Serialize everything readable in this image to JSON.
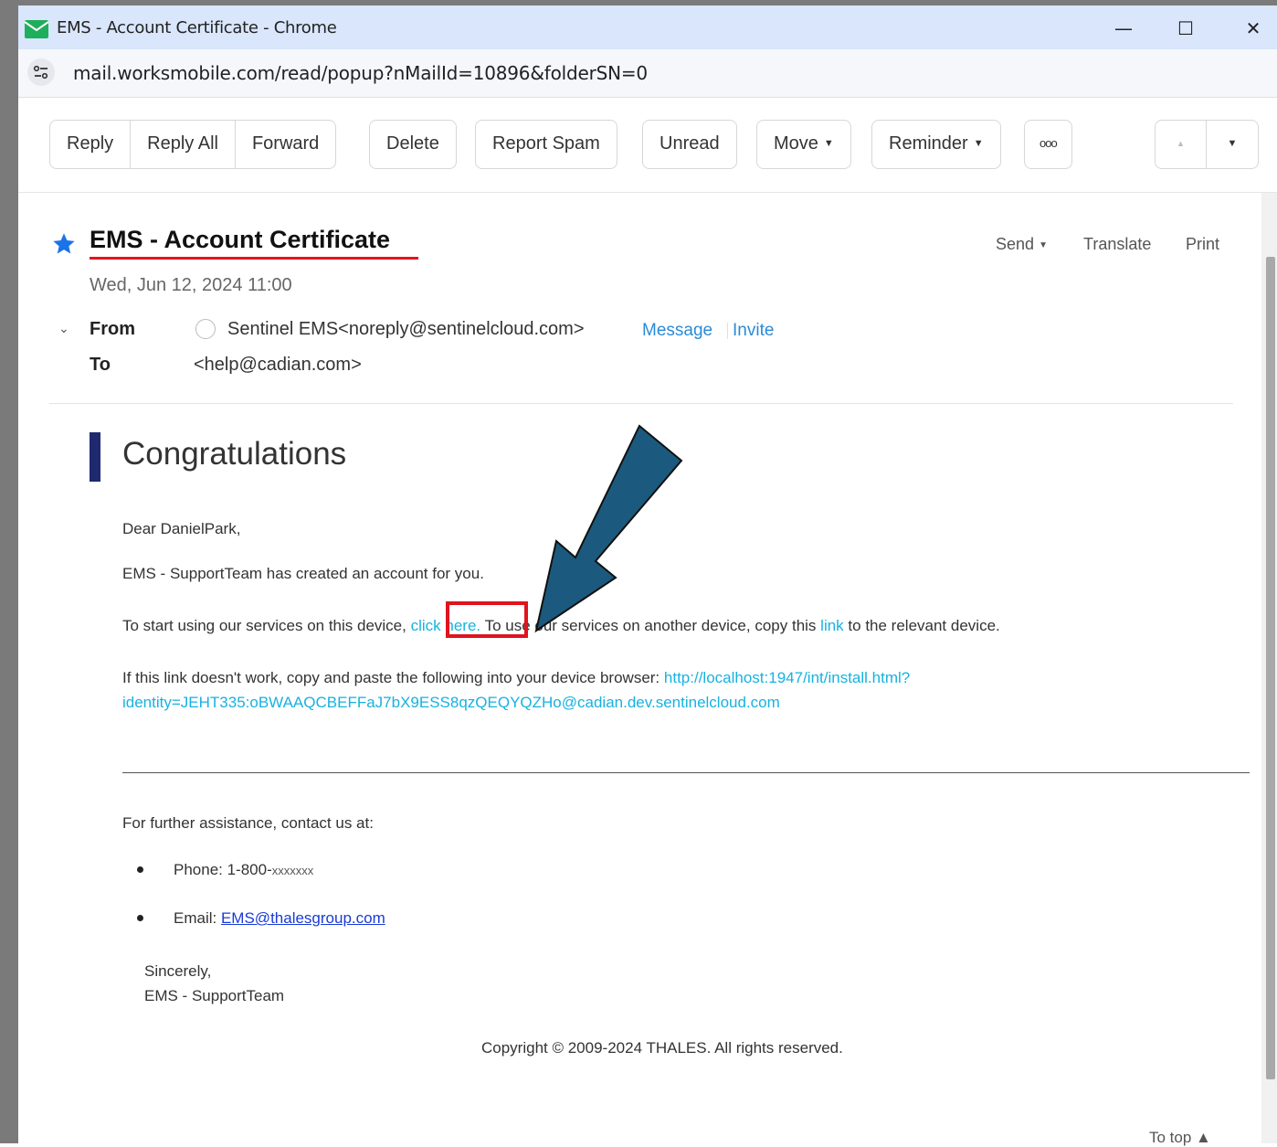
{
  "window": {
    "title": "EMS - Account Certificate - Chrome",
    "controls": {
      "minimize": "—",
      "maximize": "☐",
      "close": "✕"
    }
  },
  "address_bar": {
    "url": "mail.worksmobile.com/read/popup?nMailId=10896&folderSN=0"
  },
  "toolbar": {
    "reply": "Reply",
    "reply_all": "Reply All",
    "forward": "Forward",
    "delete": "Delete",
    "report_spam": "Report Spam",
    "unread": "Unread",
    "move": "Move",
    "reminder": "Reminder",
    "more": "ooo",
    "prev": "▲",
    "next": "▼"
  },
  "mail": {
    "subject": "EMS - Account Certificate",
    "actions": {
      "send": "Send",
      "translate": "Translate",
      "print": "Print"
    },
    "date": "Wed, Jun 12, 2024 11:00",
    "from_label": "From",
    "from_value": "Sentinel EMS<noreply@sentinelcloud.com>",
    "message_link": "Message",
    "invite_link": "Invite",
    "to_label": "To",
    "to_value": "<help@cadian.com>"
  },
  "body": {
    "heading": "Congratulations",
    "greeting": "Dear DanielPark,",
    "created": "EMS - SupportTeam has created an account for you.",
    "start_prefix": "To start using our services on this device,",
    "click_here": "click here.",
    "start_middle": "To use our services on another device, copy this",
    "link_word": "link",
    "start_suffix": "to the relevant device.",
    "fallback_prefix": "If this link doesn't work, copy and paste the following into your device browser:",
    "fallback_url_1": "http://localhost:1947/int/install.html?",
    "fallback_url_2": "identity=JEHT335:oBWAAQCBEFFaJ7bX9ESS8qzQEQYQZHo@cadian.dev.sentinelcloud.com",
    "assistance": "For further assistance, contact us at:",
    "phone_label": "Phone: 1-800-",
    "phone_number": "xxxxxxx",
    "email_label": "Email:",
    "email_value": "EMS@thalesgroup.com",
    "sincerely": "Sincerely,",
    "signature": "EMS - SupportTeam",
    "copyright": "Copyright © 2009-2024 THALES. All rights reserved.",
    "to_top": "To top ▲"
  },
  "colors": {
    "titlebar": "#d9e6fb",
    "accent_bar": "#1f2970",
    "link": "#17b2e0",
    "annotation_red": "#e1131c",
    "annotation_arrow": "#1b5a7e"
  }
}
